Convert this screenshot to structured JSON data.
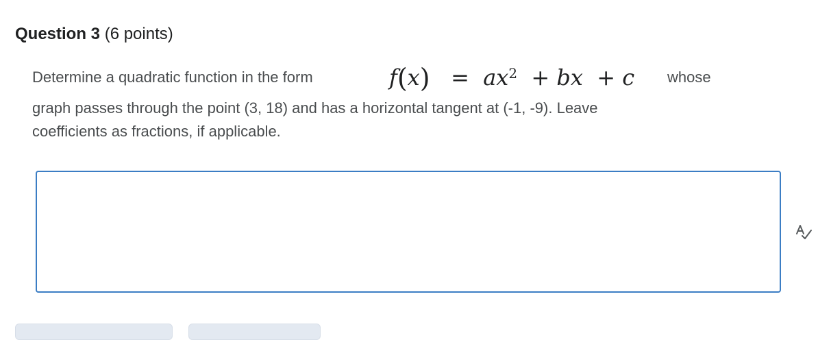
{
  "question": {
    "number_label": "Question 3",
    "points_label": "(6 points)"
  },
  "prompt": {
    "line1_prefix": "Determine a quadratic function in the form",
    "math_f": "f",
    "math_x": "x",
    "math_equals": "=",
    "math_ax": "ax",
    "math_exp": "2",
    "math_plus1": "+",
    "math_bx": "bx",
    "math_plus2": "+",
    "math_c": "c",
    "line1_suffix": "whose",
    "line2": "graph passes through the point (3, 18) and has a horizontal tangent at (-1, -9). Leave",
    "line3": "coefficients as fractions, if applicable."
  },
  "answer": {
    "value": "",
    "placeholder": ""
  },
  "icons": {
    "spellcheck": "spellcheck-icon"
  },
  "colors": {
    "input_border": "#3b7dc4",
    "button_bg": "#e3e9f1"
  }
}
